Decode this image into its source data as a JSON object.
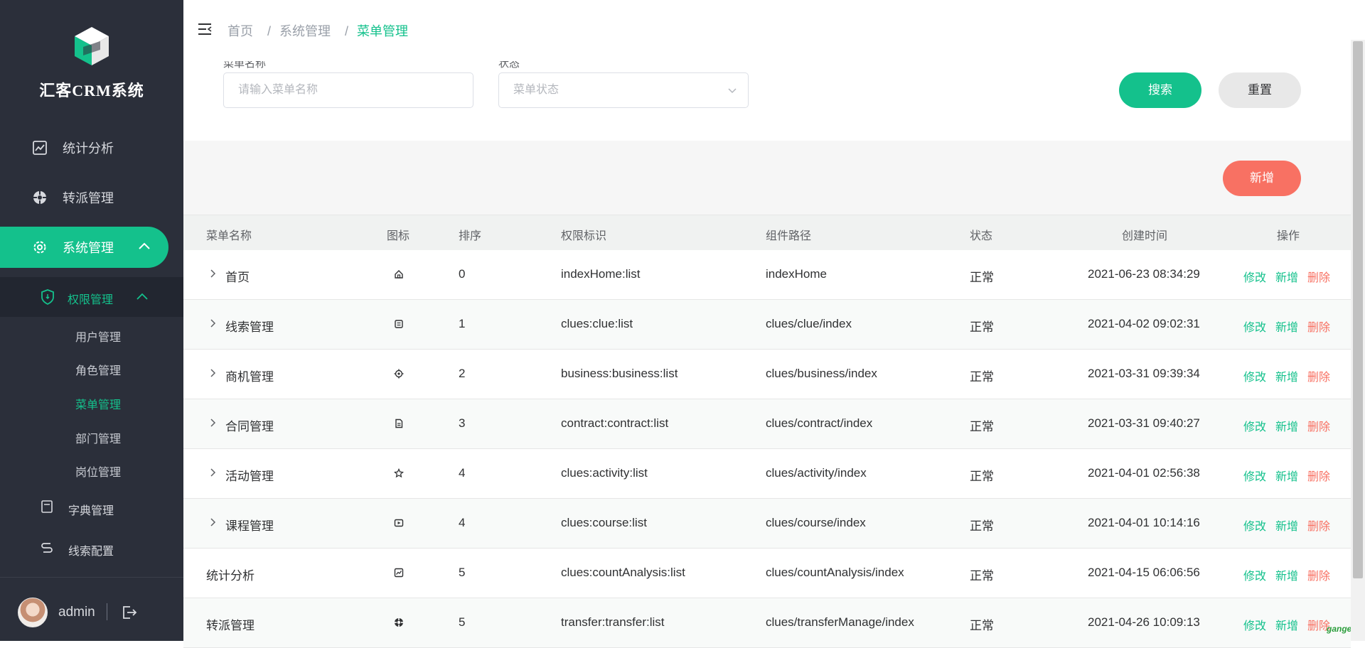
{
  "app": {
    "title": "汇客CRM系统"
  },
  "sidebar": {
    "items": [
      {
        "label": "统计分析"
      },
      {
        "label": "转派管理"
      },
      {
        "label": "系统管理"
      }
    ],
    "subgroup": {
      "label": "权限管理"
    },
    "subitems": [
      "用户管理",
      "角色管理",
      "菜单管理",
      "部门管理",
      "岗位管理"
    ],
    "items_after": [
      {
        "label": "字典管理"
      },
      {
        "label": "线索配置"
      }
    ],
    "user": {
      "name": "admin"
    },
    "colors": {
      "accent": "#14c18c",
      "bg": "#2b2f3a"
    }
  },
  "breadcrumb": [
    "首页",
    "系统管理",
    "菜单管理"
  ],
  "search": {
    "name_label": "菜单名称",
    "name_placeholder": "请输入菜单名称",
    "status_label": "状态",
    "status_placeholder": "菜单状态",
    "search_button": "搜索",
    "reset_button": "重置"
  },
  "toolbar": {
    "add_button": "新增"
  },
  "table": {
    "headers": [
      "菜单名称",
      "图标",
      "排序",
      "权限标识",
      "组件路径",
      "状态",
      "创建时间",
      "操作"
    ],
    "rows": [
      {
        "name": "首页",
        "icon": "home-icon",
        "order": "0",
        "perm": "indexHome:list",
        "path": "indexHome",
        "status": "正常",
        "created": "2021-06-23 08:34:29",
        "expandable": true
      },
      {
        "name": "线索管理",
        "icon": "clue-icon",
        "order": "1",
        "perm": "clues:clue:list",
        "path": "clues/clue/index",
        "status": "正常",
        "created": "2021-04-02 09:02:31",
        "expandable": true
      },
      {
        "name": "商机管理",
        "icon": "target-icon",
        "order": "2",
        "perm": "business:business:list",
        "path": "clues/business/index",
        "status": "正常",
        "created": "2021-03-31 09:39:34",
        "expandable": true
      },
      {
        "name": "合同管理",
        "icon": "document-icon",
        "order": "3",
        "perm": "contract:contract:list",
        "path": "clues/contract/index",
        "status": "正常",
        "created": "2021-03-31 09:40:27",
        "expandable": true
      },
      {
        "name": "活动管理",
        "icon": "star-icon",
        "order": "4",
        "perm": "clues:activity:list",
        "path": "clues/activity/index",
        "status": "正常",
        "created": "2021-04-01 02:56:38",
        "expandable": true
      },
      {
        "name": "课程管理",
        "icon": "video-icon",
        "order": "4",
        "perm": "clues:course:list",
        "path": "clues/course/index",
        "status": "正常",
        "created": "2021-04-01 10:14:16",
        "expandable": true
      },
      {
        "name": "统计分析",
        "icon": "chart-icon",
        "order": "5",
        "perm": "clues:countAnalysis:list",
        "path": "clues/countAnalysis/index",
        "status": "正常",
        "created": "2021-04-15 06:06:56",
        "expandable": false
      },
      {
        "name": "转派管理",
        "icon": "transfer-icon",
        "order": "5",
        "perm": "transfer:transfer:list",
        "path": "clues/transferManage/index",
        "status": "正常",
        "created": "2021-04-26 10:09:13",
        "expandable": false
      }
    ],
    "ops": {
      "edit": "修改",
      "add": "新增",
      "delete": "删除"
    }
  },
  "watermark": "gangeit"
}
